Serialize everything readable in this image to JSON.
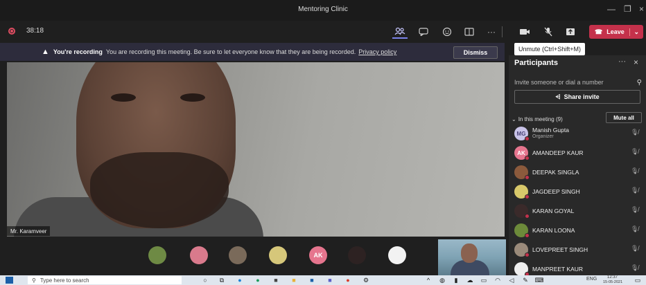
{
  "window": {
    "title": "Mentoring Clinic"
  },
  "toolbar": {
    "timer": "38:18",
    "leave_label": "Leave"
  },
  "banner": {
    "bold": "You're recording",
    "text": "You are recording this meeting. Be sure to let everyone know that they are being recorded.",
    "link": "Privacy policy",
    "dismiss": "Dismiss"
  },
  "tooltip": "Unmute (Ctrl+Shift+M)",
  "video": {
    "speaker_name": "Mr. Karamveer"
  },
  "panel": {
    "title": "Participants",
    "invite_placeholder": "Invite someone or dial a number",
    "share_invite": "Share invite",
    "section_label": "In this meeting (9)",
    "mute_all": "Mute all",
    "participants": [
      {
        "name": "Manish Gupta",
        "role": "Organizer",
        "initials": "MG",
        "color": "#c9c3e8"
      },
      {
        "name": "AMANDEEP KAUR",
        "role": "",
        "initials": "AK",
        "color": "#e6758e"
      },
      {
        "name": "DEEPAK SINGLA",
        "role": "",
        "initials": "",
        "color": "#8b5a3c"
      },
      {
        "name": "JAGDEEP SINGH",
        "role": "",
        "initials": "",
        "color": "#d8c86a"
      },
      {
        "name": "KARAN GOYAL",
        "role": "",
        "initials": "",
        "color": "#3a2a2a"
      },
      {
        "name": "KARAN LOONA",
        "role": "",
        "initials": "",
        "color": "#6c8a3a"
      },
      {
        "name": "LOVEPREET SINGH",
        "role": "",
        "initials": "",
        "color": "#9a8a7a"
      },
      {
        "name": "MANPREET KAUR",
        "role": "",
        "initials": "",
        "color": "#eeeeee"
      }
    ]
  },
  "strip": {
    "thumbs": [
      {
        "initials": "",
        "color": "#6e8a44"
      },
      {
        "initials": "",
        "color": "#d97a8c"
      },
      {
        "initials": "",
        "color": "#7a6a5a"
      },
      {
        "initials": "",
        "color": "#d6c77a"
      },
      {
        "initials": "AK",
        "color": "#e6758e"
      },
      {
        "initials": "",
        "color": "#2d2222"
      },
      {
        "initials": "",
        "color": "#f2f2f2"
      }
    ]
  },
  "taskbar": {
    "search_placeholder": "Type here to search",
    "lang": "ENG",
    "time": "12:37",
    "date": "15-05-2021"
  }
}
